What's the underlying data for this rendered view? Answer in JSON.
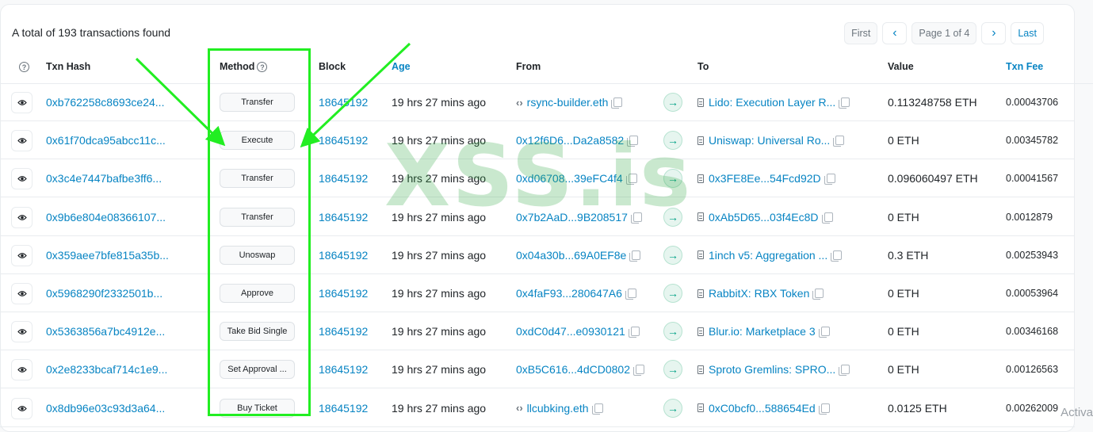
{
  "summary": "A total of 193 transactions found",
  "pager": {
    "first": "First",
    "prev": "‹",
    "page": "Page 1 of 4",
    "next": "›",
    "last": "Last"
  },
  "headers": {
    "help": "?",
    "txn_hash": "Txn Hash",
    "method": "Method",
    "block": "Block",
    "age": "Age",
    "from": "From",
    "to": "To",
    "value": "Value",
    "fee": "Txn Fee"
  },
  "rows": [
    {
      "hash": "0xb762258c8693ce24...",
      "method": "Transfer",
      "block": "18645192",
      "age": "19 hrs 27 mins ago",
      "from": "rsync-builder.eth",
      "to": "Lido: Execution Layer R...",
      "value": "0.113248758 ETH",
      "fee": "0.00043706"
    },
    {
      "hash": "0x61f70dca95abcc11c...",
      "method": "Execute",
      "block": "18645192",
      "age": "19 hrs 27 mins ago",
      "from": "0x12f6D6...Da2a8582",
      "to": "Uniswap: Universal Ro...",
      "value": "0 ETH",
      "fee": "0.00345782"
    },
    {
      "hash": "0x3c4e7447bafbe3ff6...",
      "method": "Transfer",
      "block": "18645192",
      "age": "19 hrs 27 mins ago",
      "from": "0xd06708...39eFC4f4",
      "to": "0x3FE8Ee...54Fcd92D",
      "value": "0.096060497 ETH",
      "fee": "0.00041567"
    },
    {
      "hash": "0x9b6e804e08366107...",
      "method": "Transfer",
      "block": "18645192",
      "age": "19 hrs 27 mins ago",
      "from": "0x7b2AaD...9B208517",
      "to": "0xAb5D65...03f4Ec8D",
      "value": "0 ETH",
      "fee": "0.0012879"
    },
    {
      "hash": "0x359aee7bfe815a35b...",
      "method": "Unoswap",
      "block": "18645192",
      "age": "19 hrs 27 mins ago",
      "from": "0x04a30b...69A0EF8e",
      "to": "1inch v5: Aggregation ...",
      "value": "0.3 ETH",
      "fee": "0.00253943"
    },
    {
      "hash": "0x5968290f2332501b...",
      "method": "Approve",
      "block": "18645192",
      "age": "19 hrs 27 mins ago",
      "from": "0x4faF93...280647A6",
      "to": "RabbitX: RBX Token",
      "value": "0 ETH",
      "fee": "0.00053964"
    },
    {
      "hash": "0x5363856a7bc4912e...",
      "method": "Take Bid Single",
      "block": "18645192",
      "age": "19 hrs 27 mins ago",
      "from": "0xdC0d47...e0930121",
      "to": "Blur.io: Marketplace 3",
      "value": "0 ETH",
      "fee": "0.00346168"
    },
    {
      "hash": "0x2e8233bcaf714c1e9...",
      "method": "Set Approval ...",
      "block": "18645192",
      "age": "19 hrs 27 mins ago",
      "from": "0xB5C616...4dCD0802",
      "to": "Sproto Gremlins: SPRO...",
      "value": "0 ETH",
      "fee": "0.00126563"
    },
    {
      "hash": "0x8db96e03c93d3a64...",
      "method": "Buy Ticket",
      "block": "18645192",
      "age": "19 hrs 27 mins ago",
      "from": "llcubking.eth",
      "to": "0xC0bcf0...588654Ed",
      "value": "0.0125 ETH",
      "fee": "0.00262009"
    }
  ],
  "watermark": "XSS.is",
  "os_notice": "Activa",
  "colors": {
    "link": "#0784c3",
    "highlight": "#22ee22",
    "arrow": "#00a186"
  },
  "icons": {
    "eye": "eye-icon",
    "copy": "copy-icon",
    "contract": "contract-icon",
    "code": "code-icon",
    "transfer": "arrow-right-icon",
    "help": "help-icon"
  }
}
